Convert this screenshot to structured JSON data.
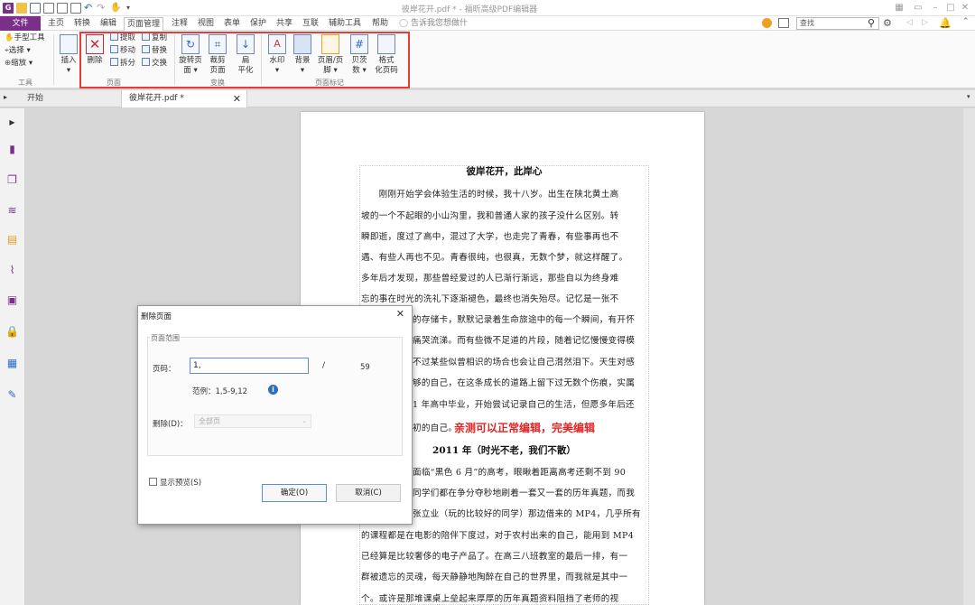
{
  "app": {
    "title": "彼岸花开.pdf * - 福昕高级PDF编辑器"
  },
  "menubar": {
    "file": "文件",
    "items": [
      "主页",
      "转换",
      "编辑",
      "页面管理",
      "注释",
      "视图",
      "表单",
      "保护",
      "共享",
      "互联",
      "辅助工具",
      "帮助"
    ],
    "active": "页面管理",
    "tellme": "告诉我您想做什",
    "search_placeholder": "查找"
  },
  "ribbon": {
    "tools_group": {
      "hand": "手型工具",
      "select": "选择",
      "zoom": "缩放",
      "label": "工具"
    },
    "insert": "插入",
    "pages_group": {
      "delete": "删除",
      "extract": "提取",
      "copy": "复制",
      "move": "移动",
      "replace": "替换",
      "split": "拆分",
      "swap": "交换",
      "label": "页面"
    },
    "transform_group": {
      "rotate_line1": "旋转页",
      "rotate_line2": "面",
      "crop_line1": "裁剪",
      "crop_line2": "页面",
      "flatten_line1": "扁",
      "flatten_line2": "平化",
      "label": "变换"
    },
    "marks_group": {
      "watermark": "水印",
      "background": "背景",
      "headerfooter_line1": "页眉/页",
      "headerfooter_line2": "脚",
      "bates_line1": "贝茨",
      "bates_line2": "数",
      "format_line1": "格式",
      "format_line2": "化页码",
      "label": "页面标记"
    }
  },
  "tabs": {
    "home": "开始",
    "doc": "彼岸花开.pdf *"
  },
  "document": {
    "title": "彼岸花开，此岸心",
    "lines": [
      "　　刚刚开始学会体验生活的时候，我十八岁。出生在陕北黄土高",
      "坡的一个不起眼的小山沟里，我和普通人家的孩子没什么区别。转",
      "瞬即逝，度过了高中，混过了大学，也走完了青春，有些事再也不",
      "遇、有些人再也不见。青春很纯，也很真，无数个梦，就这样醒了。",
      "多年后才发现，那些曾经爱过的人已渐行渐远，那些自以为终身难",
      "忘的事在时光的洗礼下逐渐褪色，最终也消失殆尽。记忆是一张不",
      "的存储卡，默默记录着生命旅途中的每一个瞬间，有开怀",
      "痛哭流涕。而有些微不足道的片段，随着记忆慢慢变得模",
      "不过某些似曾相识的场合也会让自己潸然泪下。天生对感",
      "够的自己，在这条成长的道路上留下过无数个伤痕，实属",
      "1 年高中毕业，开始尝试记录自己的生活，但愿多年后还",
      "初的自己。"
    ],
    "red_note": "亲测可以正常编辑，完美编辑",
    "section_title": "2011 年（时光不老，我们不散）",
    "lines2": [
      "面临“黑色 6 月”的高考，眼瞅着距离高考还剩不到 90",
      "同学们都在争分夺秒地刷着一套又一套的历年真题，而我",
      "张立业（玩的比较好的同学）那边借来的 MP4，几乎所有",
      "的课程都是在电影的陪伴下度过，对于农村出来的自己，能用到 MP4",
      "已经算是比较奢侈的电子产品了。在高三八班教室的最后一排，有一",
      "群被遗忘的灵魂，每天静静地陶醉在自己的世界里，而我就是其中一",
      "个。或许是那堆课桌上垒起来厚厚的历年真题资料阻挡了老师的视"
    ]
  },
  "dialog": {
    "title": "删除页面",
    "range_label": "页面范围",
    "page_label": "页码：",
    "page_value": "1,",
    "slash": "/",
    "total": "59",
    "example": "范例：1,5-9,12",
    "delete_label": "删除(D)：",
    "delete_option": "全部页",
    "preview_label": "显示预览(S)",
    "ok": "确定(O)",
    "cancel": "取消(C)"
  }
}
